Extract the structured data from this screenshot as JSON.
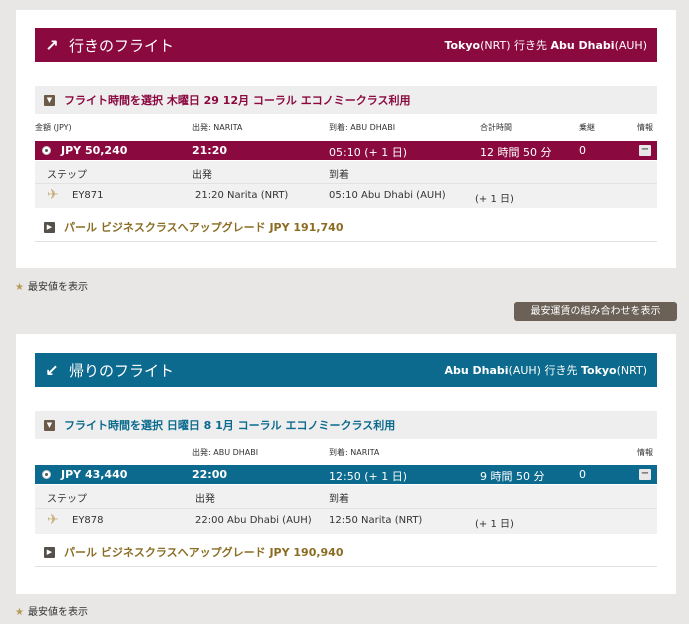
{
  "outbound": {
    "direction_icon": "arrow-up-right-icon",
    "arrow": "↗",
    "title": "行きのフライト",
    "route_from": "Tokyo",
    "route_from_code": "(NRT)",
    "route_mid": " 行き先 ",
    "route_to": "Abu Dhabi",
    "route_to_code": "(AUH)",
    "select_label": "フライト時間を選択 木曜日 29 12月 コーラル エコノミークラス利用",
    "columns": {
      "price": "金額 (JPY)",
      "depart": "出発: NARITA",
      "arrive": "到着: ABU DHABI",
      "total": "合計時間",
      "transfer": "乗継",
      "info": "情報"
    },
    "selected": {
      "price": "JPY 50,240",
      "depart": "21:20",
      "arrive": "05:10 (+ 1 日)",
      "total": "12 時間 50 分",
      "transfer": "0",
      "info": "−"
    },
    "sub_head": {
      "step": "ステップ",
      "depart": "出発",
      "arrive": "到着"
    },
    "leg": {
      "flight": "EY871",
      "depart": "21:20 Narita (NRT)",
      "arrive": "05:10 Abu Dhabi (AUH)",
      "offset": "(+ 1 日)"
    },
    "upgrade": "パール ビジネスクラスへアップグレード JPY 191,740",
    "lowest": "最安値を表示"
  },
  "combo_button": "最安運賃の組み合わせを表示",
  "return": {
    "direction_icon": "arrow-down-left-icon",
    "arrow": "↙",
    "title": "帰りのフライト",
    "route_from": "Abu Dhabi",
    "route_from_code": "(AUH)",
    "route_mid": " 行き先 ",
    "route_to": "Tokyo",
    "route_to_code": "(NRT)",
    "select_label": "フライト時間を選択 日曜日 8 1月 コーラル エコノミークラス利用",
    "columns": {
      "price": "",
      "depart": "出発: ABU DHABI",
      "arrive": "到着: NARITA",
      "total": "",
      "transfer": "",
      "info": "情報"
    },
    "selected": {
      "price": "JPY 43,440",
      "depart": "22:00",
      "arrive": "12:50 (+ 1 日)",
      "total": "9 時間 50 分",
      "transfer": "0",
      "info": "−"
    },
    "sub_head": {
      "step": "ステップ",
      "depart": "出発",
      "arrive": "到着"
    },
    "leg": {
      "flight": "EY878",
      "depart": "22:00 Abu Dhabi (AUH)",
      "arrive": "12:50 Narita (NRT)",
      "offset": "(+ 1 日)"
    },
    "upgrade": "パール ビジネスクラスへアップグレード JPY 190,940",
    "lowest": "最安値を表示"
  },
  "colors": {
    "outbound_accent": "#8a0a40",
    "return_accent": "#0b6a8e",
    "upgrade_text": "#8a6d23"
  }
}
